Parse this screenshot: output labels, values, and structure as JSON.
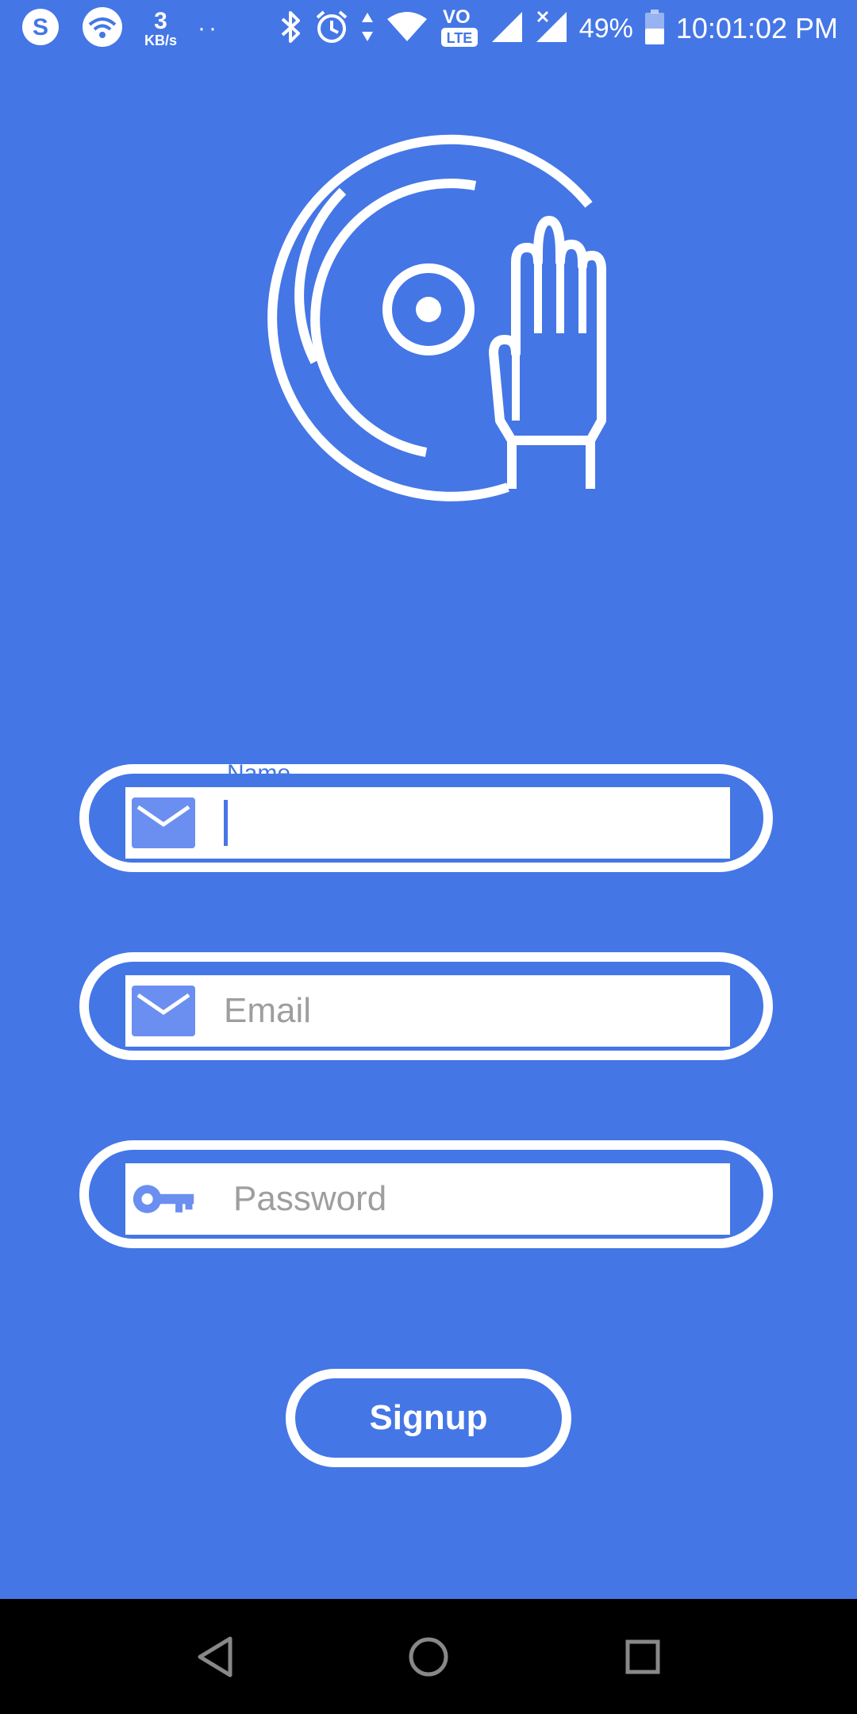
{
  "status_bar": {
    "net_speed_value": "3",
    "net_speed_unit": "KB/s",
    "dots": "··",
    "volte_label": "VO",
    "lte_label": "LTE",
    "battery_percent": "49%",
    "time": "10:01:02 PM"
  },
  "form": {
    "name": {
      "label": "Name",
      "value": "",
      "icon": "mail-icon"
    },
    "email": {
      "placeholder": "Email",
      "icon": "mail-icon"
    },
    "password": {
      "placeholder": "Password",
      "icon": "key-icon"
    }
  },
  "signup_label": "Signup",
  "colors": {
    "background": "#4476e6",
    "icon_blue": "#6b8ff0",
    "white": "#ffffff",
    "nav_bar": "#000000"
  }
}
